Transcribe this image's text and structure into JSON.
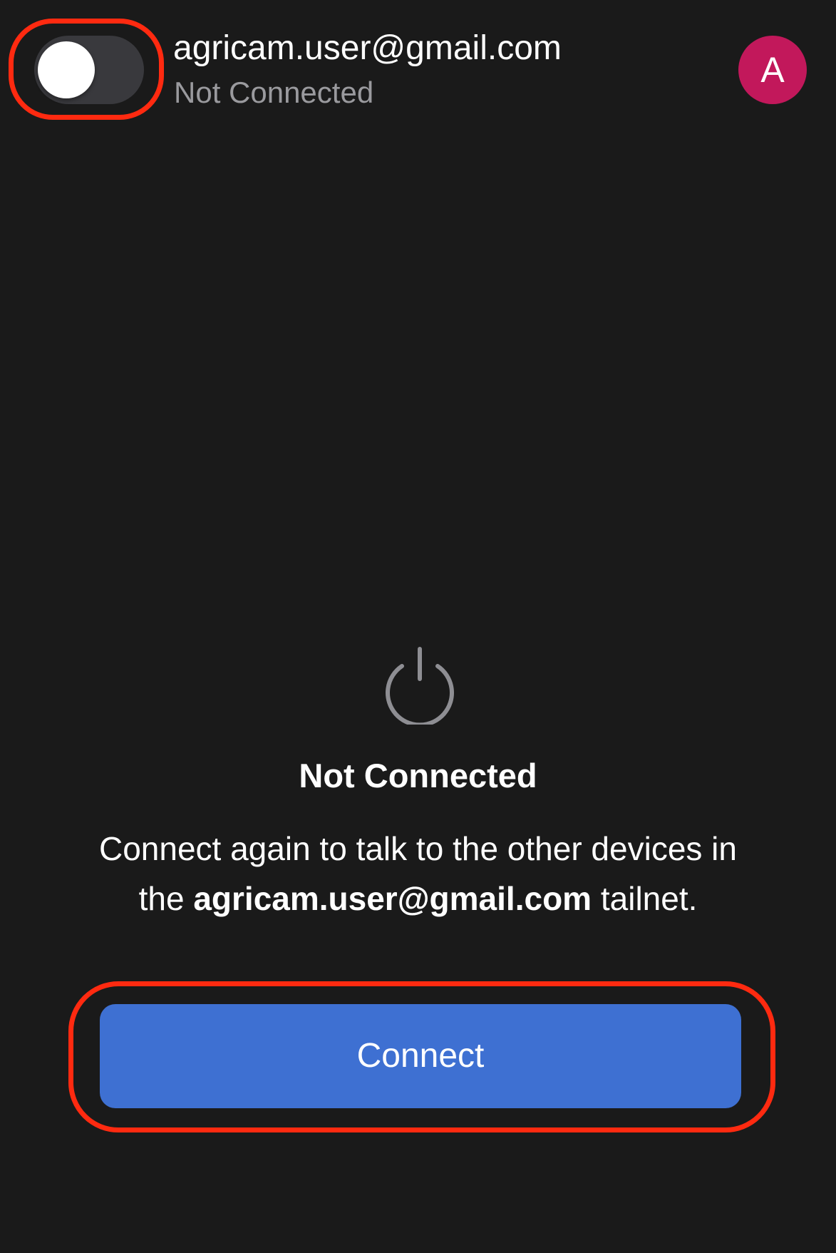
{
  "header": {
    "vpn_toggle_state": "off",
    "account_email": "agricam.user@gmail.com",
    "account_status": "Not Connected",
    "avatar_initial": "A",
    "avatar_color": "#c2185b"
  },
  "main": {
    "icon": "power-icon",
    "status_title": "Not Connected",
    "description_prefix": "Connect again to talk to the other devices in the",
    "description_tailnet": "agricam.user@gmail.com",
    "description_suffix": "tailnet.",
    "connect_button_label": "Connect"
  },
  "colors": {
    "background": "#1a1a1a",
    "button": "#3e70d2",
    "highlight": "#ff2a10"
  }
}
